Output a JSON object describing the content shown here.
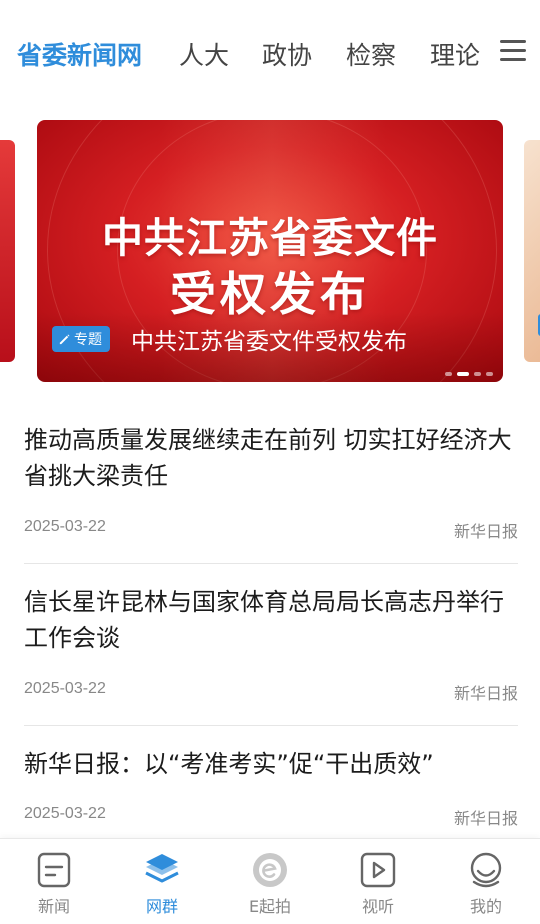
{
  "top_tabs": [
    {
      "label": "省委新闻网",
      "active": true
    },
    {
      "label": "人大",
      "active": false
    },
    {
      "label": "政协",
      "active": false
    },
    {
      "label": "检察",
      "active": false
    },
    {
      "label": "理论",
      "active": false
    }
  ],
  "menu_icon": "hamburger-menu-icon",
  "banner": {
    "image_text_line1": "中共江苏省委文件",
    "image_text_line2": "受权发布",
    "badge_label": "专题",
    "badge_icon": "edit-icon",
    "caption": "中共江苏省委文件受权发布",
    "slide_count": 4,
    "active_index": 1,
    "background_color": "#d51f22",
    "badge_color": "#2f8ddb"
  },
  "news": [
    {
      "title": "推动高质量发展继续走在前列  切实扛好经济大省挑大梁责任",
      "date": "2025-03-22",
      "source": "新华日报"
    },
    {
      "title": "信长星许昆林与国家体育总局局长高志丹举行工作会谈",
      "date": "2025-03-22",
      "source": "新华日报"
    },
    {
      "title": "新华日报：以“考准考实”促“干出质效”",
      "date": "2025-03-22",
      "source": "新华日报"
    }
  ],
  "bottom_nav": [
    {
      "label": "新闻",
      "icon": "news-document-icon",
      "active": false
    },
    {
      "label": "网群",
      "icon": "layers-icon",
      "active": true
    },
    {
      "label": "E起拍",
      "icon": "e-camera-icon",
      "active": false
    },
    {
      "label": "视听",
      "icon": "play-video-icon",
      "active": false
    },
    {
      "label": "我的",
      "icon": "user-profile-icon",
      "active": false
    }
  ],
  "accent_color": "#2f8ddb"
}
